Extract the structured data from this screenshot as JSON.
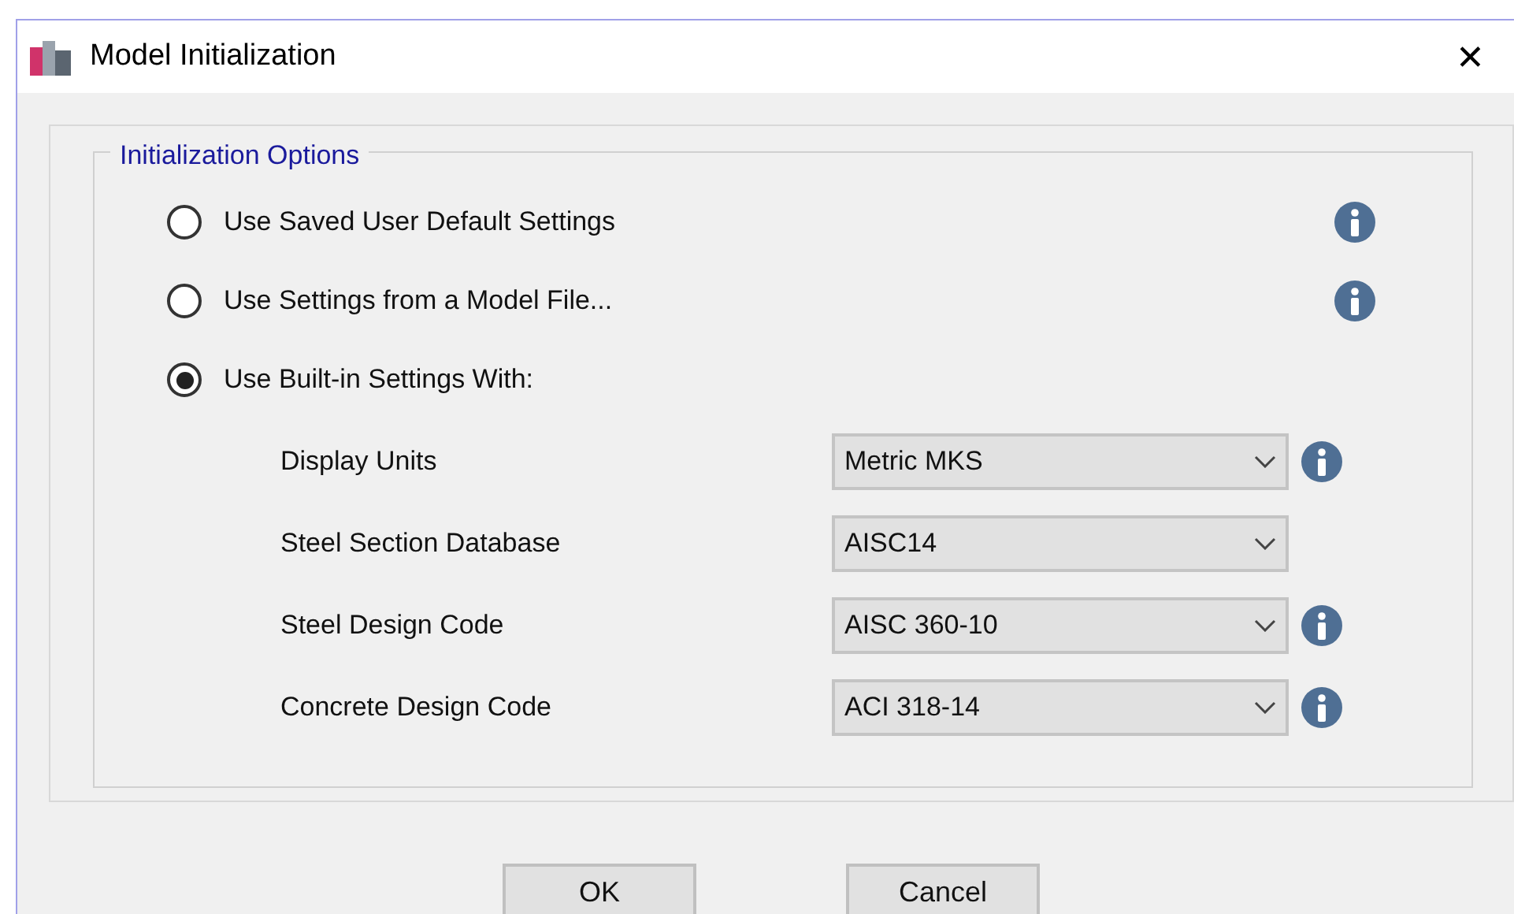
{
  "window": {
    "title": "Model Initialization",
    "close": "✕"
  },
  "group": {
    "title": "Initialization Options"
  },
  "options": [
    {
      "label": "Use Saved User Default Settings",
      "selected": false,
      "info": true
    },
    {
      "label": "Use Settings from a Model File...",
      "selected": false,
      "info": true
    },
    {
      "label": "Use Built-in Settings With:",
      "selected": true,
      "info": false
    }
  ],
  "settings": [
    {
      "label": "Display Units",
      "value": "Metric MKS",
      "info": true
    },
    {
      "label": "Steel Section Database",
      "value": "AISC14",
      "info": false
    },
    {
      "label": "Steel Design Code",
      "value": "AISC 360-10",
      "info": true
    },
    {
      "label": "Concrete Design Code",
      "value": "ACI 318-14",
      "info": true
    }
  ],
  "buttons": [
    "OK",
    "Cancel"
  ]
}
